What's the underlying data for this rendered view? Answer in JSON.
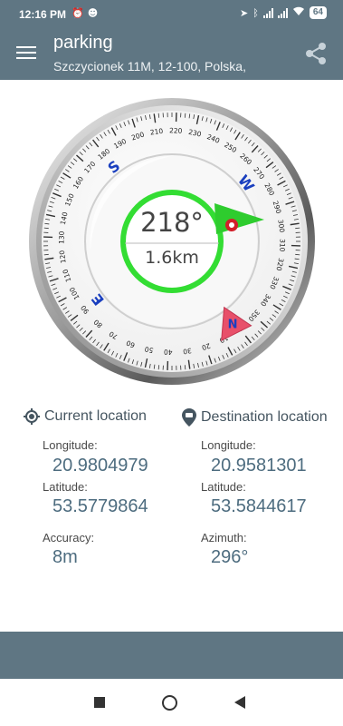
{
  "status_bar": {
    "time": "12:16 PM",
    "battery": "64"
  },
  "app_bar": {
    "title": "parking",
    "subtitle": "Szczycionek 11M, 12-100, Polska,"
  },
  "compass": {
    "bearing_text": "218°",
    "distance_text": "1.6km",
    "cardinals": {
      "n": "N",
      "e": "E",
      "s": "S",
      "w": "W"
    },
    "colors": {
      "ring": "#33dd33",
      "pointer": "#2ecc2e",
      "north_marker": "#e8506a",
      "cardinal_text": "#1a3fbf"
    }
  },
  "current_location": {
    "header": "Current location",
    "longitude_label": "Longitude:",
    "longitude": "20.9804979",
    "latitude_label": "Latitude:",
    "latitude": "53.5779864",
    "accuracy_label": "Accuracy:",
    "accuracy": "8m"
  },
  "destination_location": {
    "header": "Destination location",
    "longitude_label": "Longitude:",
    "longitude": "20.9581301",
    "latitude_label": "Latitude:",
    "latitude": "53.5844617",
    "azimuth_label": "Azimuth:",
    "azimuth": "296°"
  },
  "icons": [
    "hamburger-menu-icon",
    "share-icon",
    "my-location-icon",
    "destination-pin-icon",
    "wifi-icon",
    "bluetooth-icon",
    "alarm-icon"
  ]
}
